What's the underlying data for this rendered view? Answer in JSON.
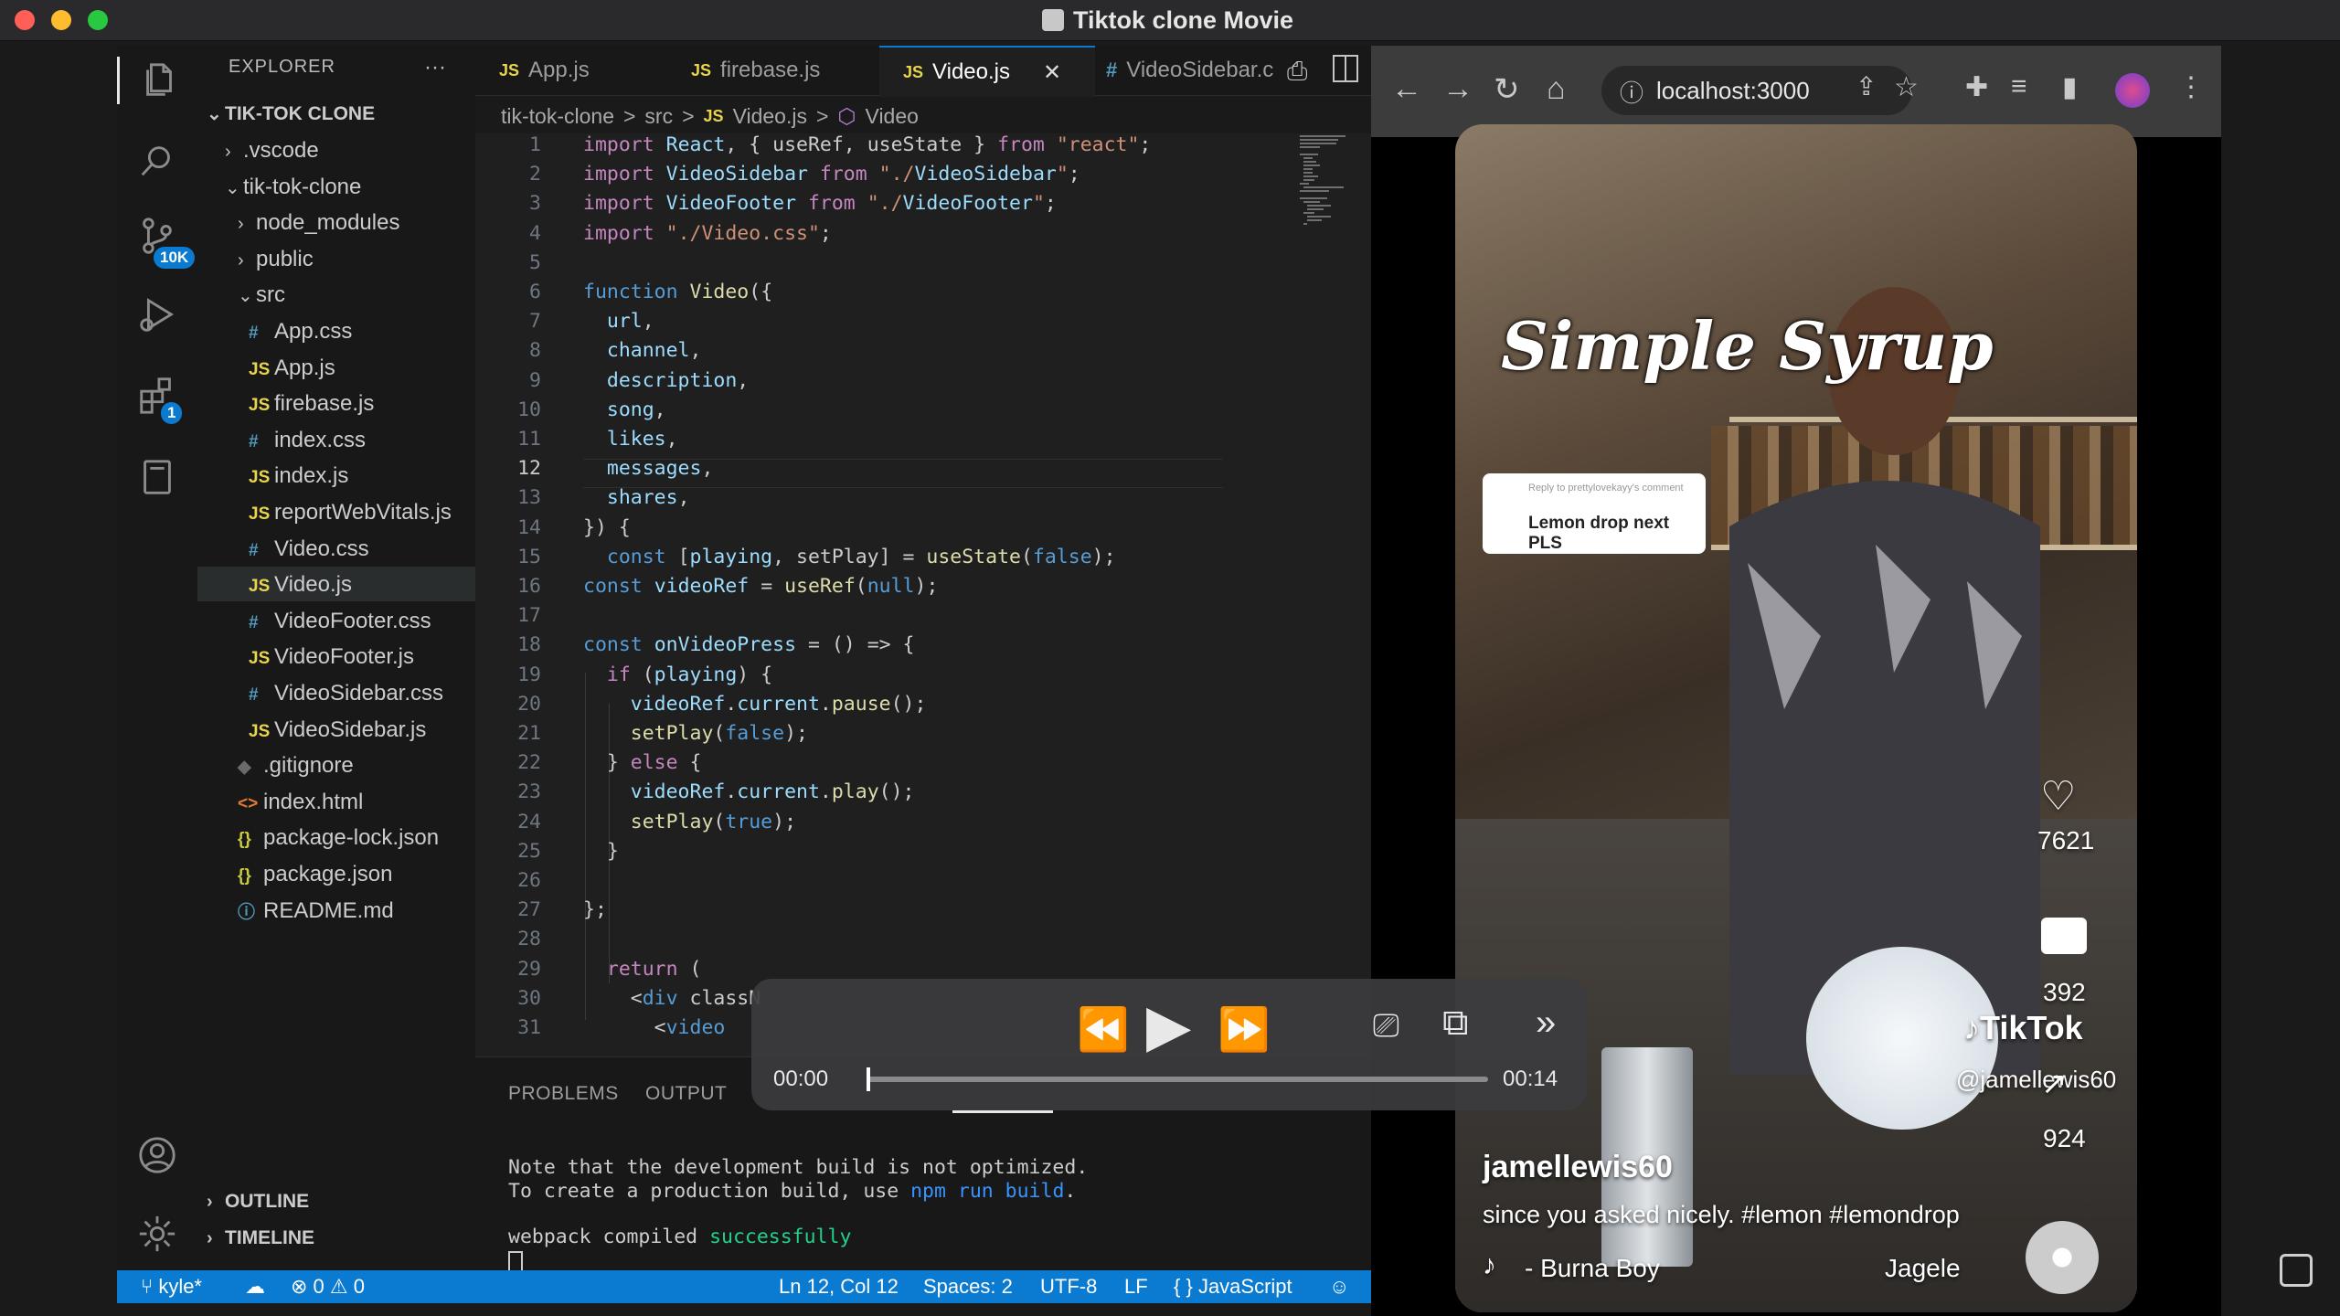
{
  "window": {
    "title": "Tiktok clone Movie",
    "traffic_colors": {
      "close": "#ff5f57",
      "minimize": "#febc2e",
      "maximize": "#28c840"
    }
  },
  "activity_bar": {
    "source_control_badge": "10K",
    "extensions_badge": "1"
  },
  "sidebar": {
    "header": "EXPLORER",
    "more": "···",
    "root": "TIK-TOK CLONE",
    "items": [
      {
        "label": ".vscode",
        "icon": "chevron-right",
        "depth": 1
      },
      {
        "label": "tik-tok-clone",
        "icon": "chevron-down",
        "depth": 1
      },
      {
        "label": "node_modules",
        "icon": "chevron-right",
        "depth": 2
      },
      {
        "label": "public",
        "icon": "chevron-right",
        "depth": 2
      },
      {
        "label": "src",
        "icon": "chevron-down",
        "depth": 2
      },
      {
        "label": "App.css",
        "icon": "#",
        "depth": 3
      },
      {
        "label": "App.js",
        "icon": "JS",
        "depth": 3
      },
      {
        "label": "firebase.js",
        "icon": "JS",
        "depth": 3
      },
      {
        "label": "index.css",
        "icon": "#",
        "depth": 3
      },
      {
        "label": "index.js",
        "icon": "JS",
        "depth": 3
      },
      {
        "label": "reportWebVitals.js",
        "icon": "JS",
        "depth": 3
      },
      {
        "label": "Video.css",
        "icon": "#",
        "depth": 3
      },
      {
        "label": "Video.js",
        "icon": "JS",
        "depth": 3
      },
      {
        "label": "VideoFooter.css",
        "icon": "#",
        "depth": 3
      },
      {
        "label": "VideoFooter.js",
        "icon": "JS",
        "depth": 3
      },
      {
        "label": "VideoSidebar.css",
        "icon": "#",
        "depth": 3
      },
      {
        "label": "VideoSidebar.js",
        "icon": "JS",
        "depth": 3
      },
      {
        "label": ".gitignore",
        "icon": "◆",
        "depth": 2
      },
      {
        "label": "index.html",
        "icon": "<>",
        "depth": 2
      },
      {
        "label": "package-lock.json",
        "icon": "{}",
        "depth": 2
      },
      {
        "label": "package.json",
        "icon": "{}",
        "depth": 2
      },
      {
        "label": "README.md",
        "icon": "ⓘ",
        "depth": 2
      }
    ],
    "outline": "OUTLINE",
    "timeline": "TIMELINE"
  },
  "tabs": [
    {
      "label": "App.js",
      "type": "JS"
    },
    {
      "label": "firebase.js",
      "type": "JS"
    },
    {
      "label": "Video.js",
      "type": "JS",
      "active": true,
      "close": "✕"
    },
    {
      "label": "VideoSidebar.c",
      "type": "#"
    }
  ],
  "breadcrumb": {
    "folder": "tik-tok-clone",
    "sep": ">",
    "src": "src",
    "file": "Video.js",
    "symbol": "Video"
  },
  "editor": {
    "current_line": 12,
    "lines": [
      "import React, { useRef, useState } from \"react\";",
      "import VideoSidebar from \"./VideoSidebar\";",
      "import VideoFooter from \"./VideoFooter\";",
      "import \"./Video.css\";",
      "",
      "function Video({",
      "  url,",
      "  channel,",
      "  description,",
      "  song,",
      "  likes,",
      "  messages,",
      "  shares,",
      "}) {",
      "  const [playing, setPlay] = useState(false);",
      "const videoRef = useRef(null);",
      "",
      "const onVideoPress = () => {",
      "  if (playing) {",
      "    videoRef.current.pause();",
      "    setPlay(false);",
      "  } else {",
      "    videoRef.current.play();",
      "    setPlay(true);",
      "  }",
      "",
      "};",
      "",
      "  return (",
      "    <div classN",
      "      <video"
    ]
  },
  "panel": {
    "tabs": [
      "PROBLEMS",
      "OUTPUT"
    ],
    "terminal": [
      "Note that the development build is not optimized.",
      "To create a production build, use npm run build.",
      "",
      "webpack compiled successfully"
    ],
    "npm_cmd": "npm run build",
    "success_word": "successfully"
  },
  "statusbar": {
    "branch": "kyle*",
    "errors": "0",
    "warnings": "0",
    "position": "Ln 12, Col 12",
    "spaces": "Spaces: 2",
    "encoding": "UTF-8",
    "eol": "LF",
    "language": "JavaScript",
    "language_icon": "{ }"
  },
  "browser": {
    "url": "localhost:3000"
  },
  "video": {
    "title_overlay": "Simple Syrup",
    "comment_reply": "Reply to prettylovekayy's comment",
    "comment_text": "Lemon drop next PLS",
    "likes": "7621",
    "messages": "392",
    "shares": "924",
    "tiktok_brand": "TikTok",
    "tiktok_handle": "@jamellewis60",
    "channel": "jamellewis60",
    "description": "since you asked nicely. #lemon #lemondrop",
    "song": "- Burna Boy",
    "song_right": "Jagele"
  },
  "player": {
    "current_time": "00:00",
    "duration": "00:14",
    "progress": 0.0
  },
  "colors": {
    "accent": "#0a7bd1",
    "editor_bg": "#1f1f1f",
    "sidebar_bg": "#181818",
    "keyword": "#c586c0",
    "function": "#dcdcaa",
    "string": "#ce9178",
    "variable": "#9cdcfe",
    "success": "#23d18b"
  }
}
